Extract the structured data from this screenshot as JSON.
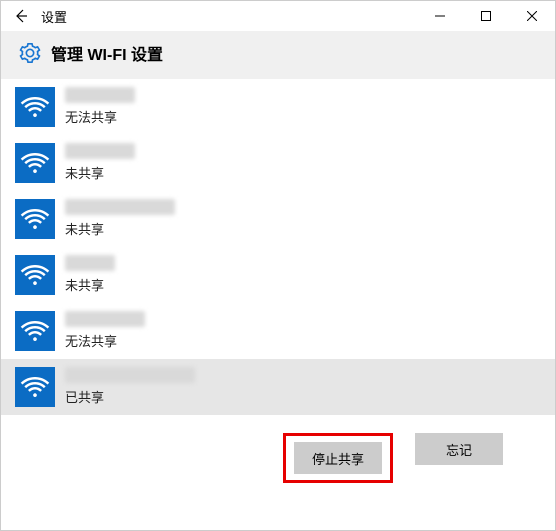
{
  "titlebar": {
    "title": "设置"
  },
  "header": {
    "title": "管理 WI-FI 设置"
  },
  "networks": [
    {
      "name_width": 70,
      "status": "无法共享",
      "selected": false
    },
    {
      "name_width": 70,
      "status": "未共享",
      "selected": false
    },
    {
      "name_width": 110,
      "status": "未共享",
      "selected": false
    },
    {
      "name_width": 50,
      "status": "未共享",
      "selected": false
    },
    {
      "name_width": 80,
      "status": "无法共享",
      "selected": false
    },
    {
      "name_width": 130,
      "status": "已共享",
      "selected": true
    }
  ],
  "actions": {
    "stop_share": "停止共享",
    "forget": "忘记"
  }
}
